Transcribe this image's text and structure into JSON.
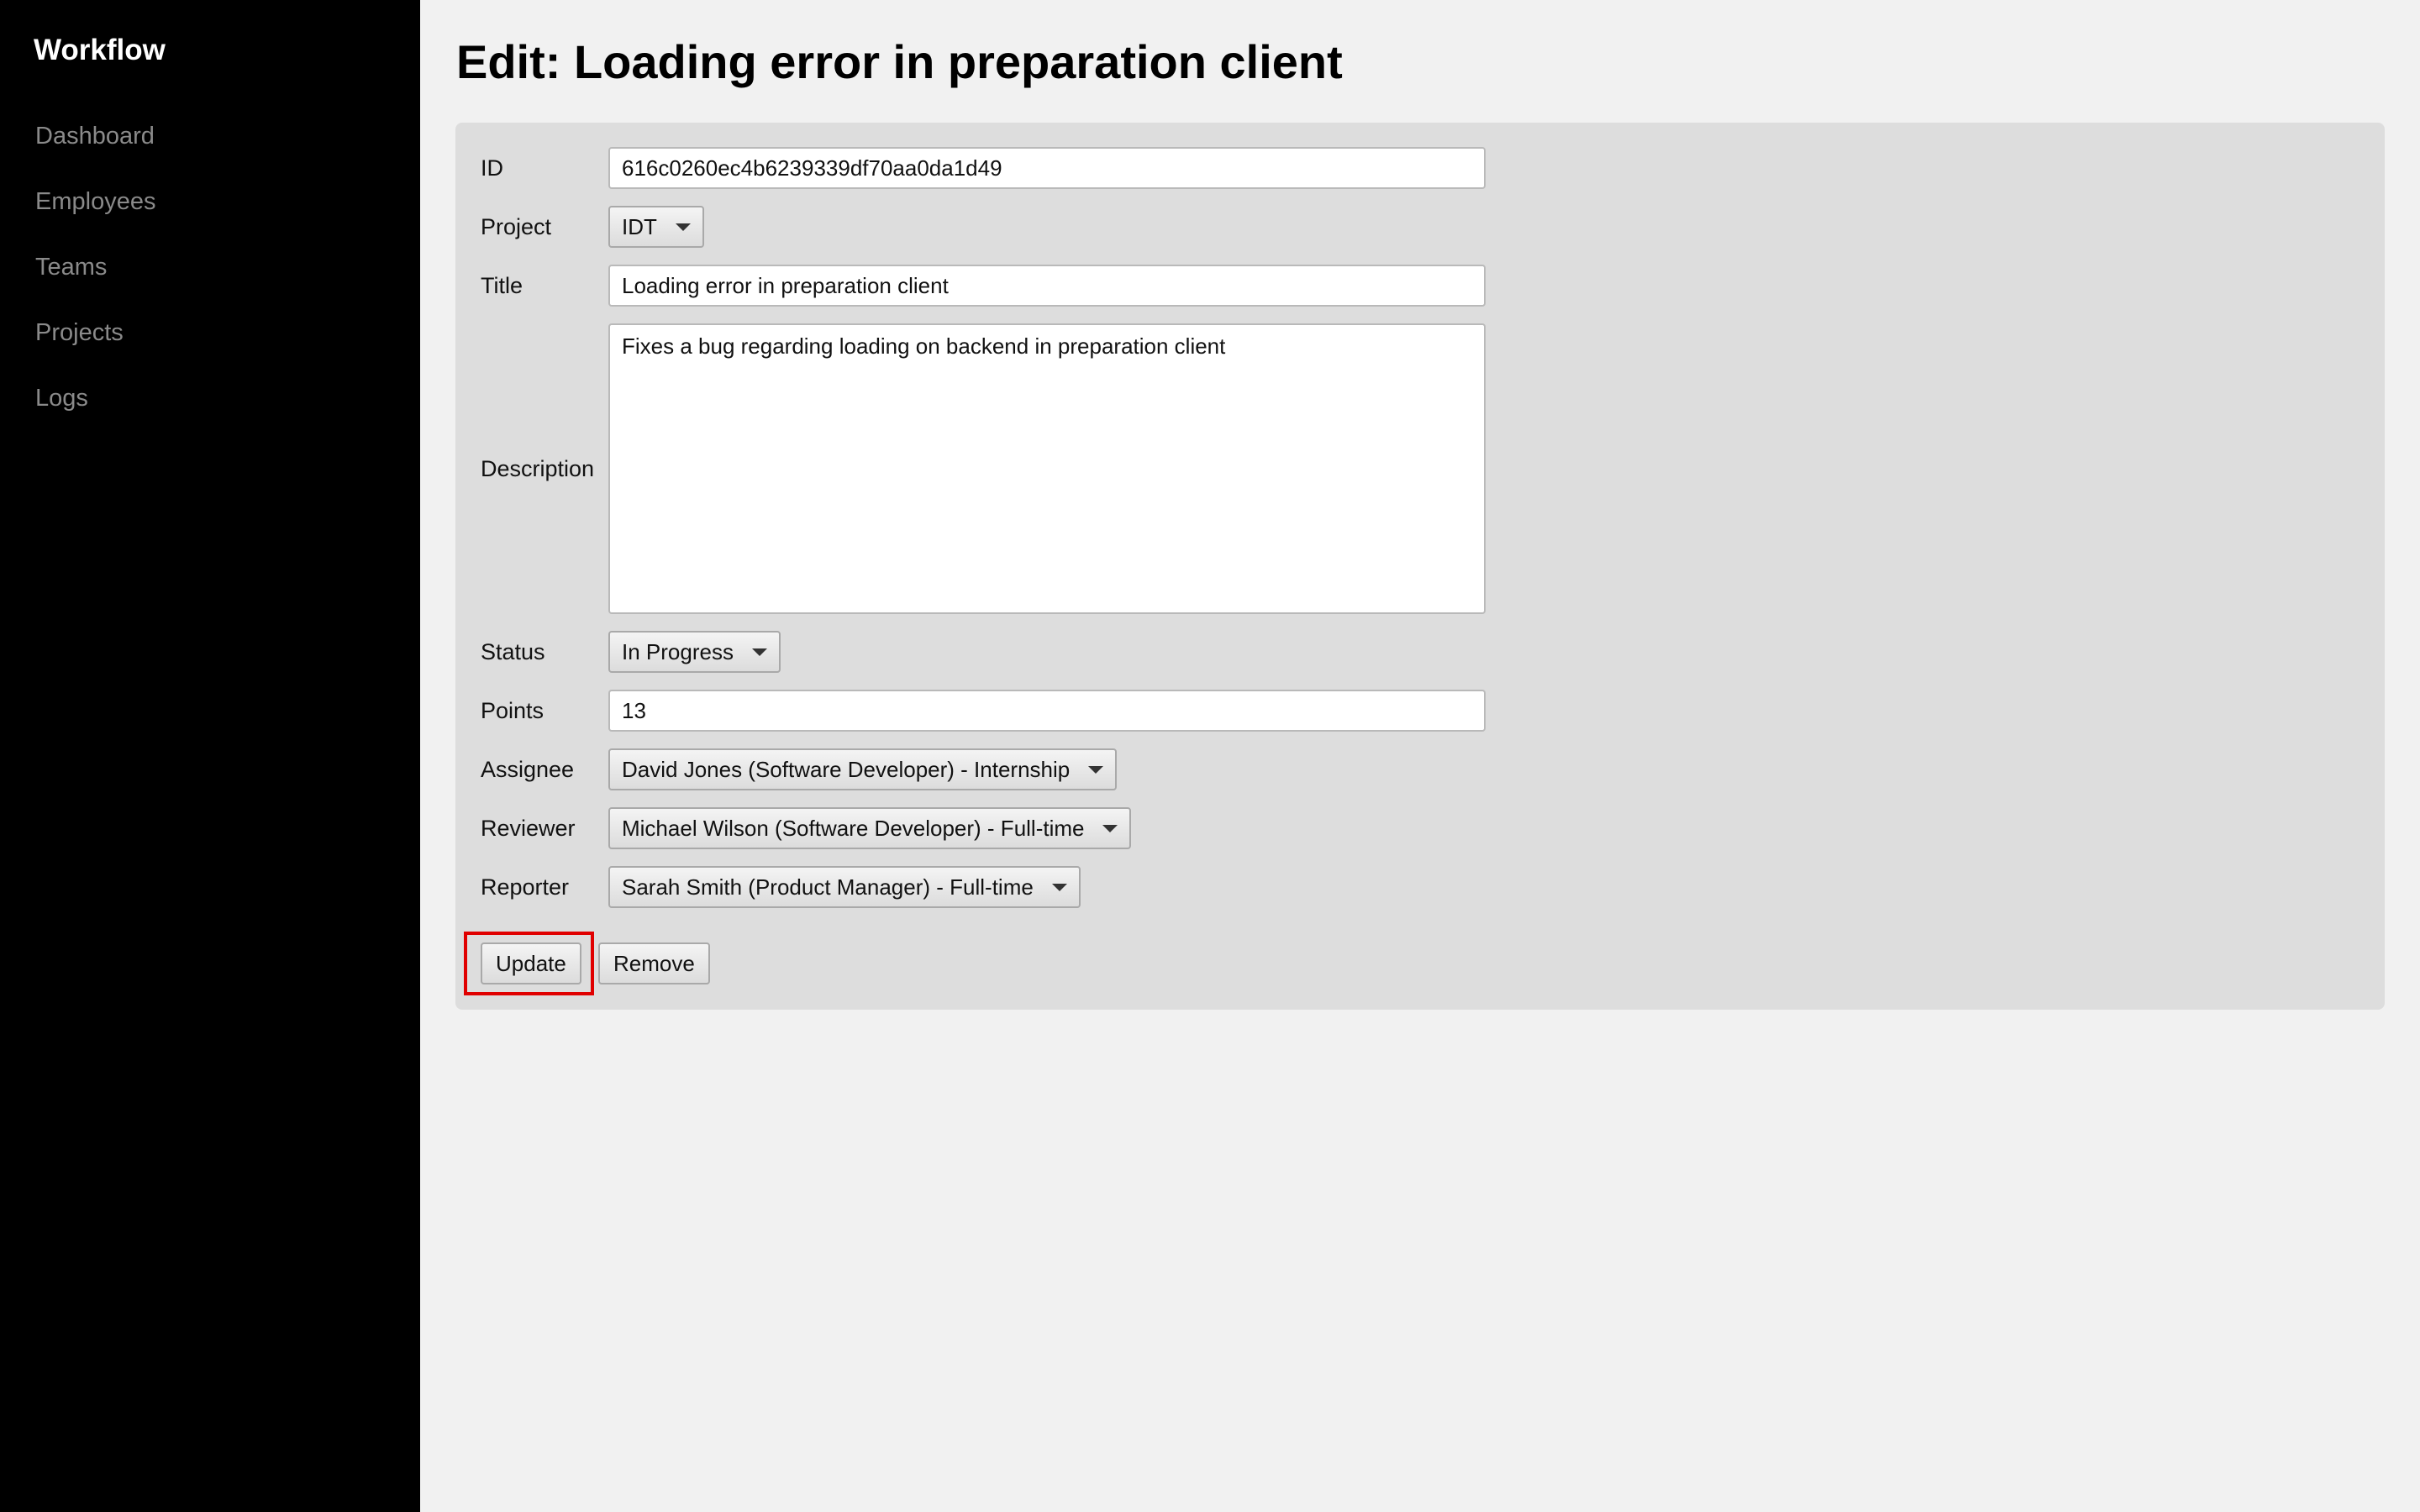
{
  "sidebar": {
    "brand": "Workflow",
    "items": [
      {
        "label": "Dashboard"
      },
      {
        "label": "Employees"
      },
      {
        "label": "Teams"
      },
      {
        "label": "Projects"
      },
      {
        "label": "Logs"
      }
    ]
  },
  "page": {
    "title": "Edit: Loading error in preparation client"
  },
  "form": {
    "id": {
      "label": "ID",
      "value": "616c0260ec4b6239339df70aa0da1d49"
    },
    "project": {
      "label": "Project",
      "value": "IDT"
    },
    "title": {
      "label": "Title",
      "value": "Loading error in preparation client"
    },
    "description": {
      "label": "Description",
      "value": "Fixes a bug regarding loading on backend in preparation client"
    },
    "status": {
      "label": "Status",
      "value": "In Progress"
    },
    "points": {
      "label": "Points",
      "value": "13"
    },
    "assignee": {
      "label": "Assignee",
      "value": "David Jones (Software Developer) - Internship"
    },
    "reviewer": {
      "label": "Reviewer",
      "value": "Michael Wilson (Software Developer) - Full-time"
    },
    "reporter": {
      "label": "Reporter",
      "value": "Sarah Smith (Product Manager) - Full-time"
    }
  },
  "actions": {
    "update_label": "Update",
    "remove_label": "Remove"
  },
  "colors": {
    "sidebar_bg": "#000000",
    "page_bg": "#f1f1f1",
    "panel_bg": "#dddddd",
    "highlight": "#e00000"
  }
}
